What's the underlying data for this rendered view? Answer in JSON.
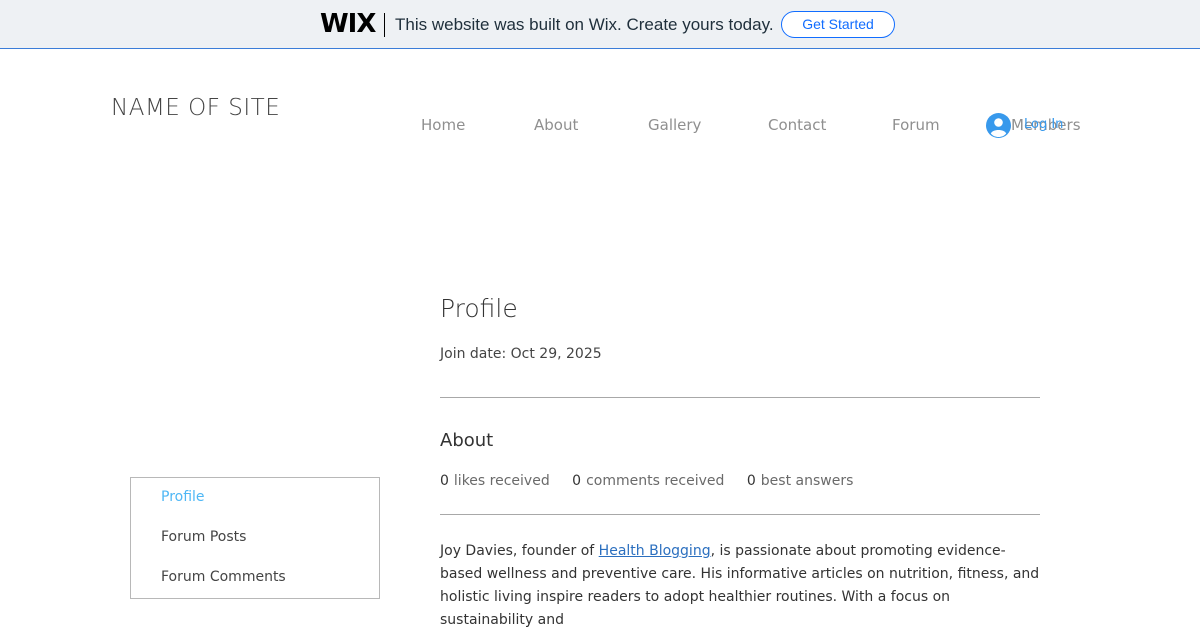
{
  "wix_banner": {
    "logo": "WIX",
    "message": "This website was built on Wix. Create yours today.",
    "cta_label": "Get Started",
    "accent_color": "#116dff"
  },
  "header": {
    "site_name": "NAME OF SITE",
    "nav": [
      {
        "label": "Home"
      },
      {
        "label": "About"
      },
      {
        "label": "Gallery"
      },
      {
        "label": "Contact"
      },
      {
        "label": "Forum"
      },
      {
        "label": "Members"
      }
    ],
    "login": {
      "label": "Log In",
      "icon": "user-avatar-icon"
    }
  },
  "side_menu": {
    "items": [
      {
        "label": "Profile",
        "active": true
      },
      {
        "label": "Forum Posts",
        "active": false
      },
      {
        "label": "Forum Comments",
        "active": false
      }
    ],
    "active_color": "#4eb7f5"
  },
  "profile": {
    "title": "Profile",
    "join_date": "Join date: Oct 29, 2025",
    "about_heading": "About",
    "stats": [
      {
        "value": "0",
        "label": "likes received"
      },
      {
        "value": "0",
        "label": "comments received"
      },
      {
        "value": "0",
        "label": "best answers"
      }
    ],
    "bio": {
      "before_link": "Joy Davies, founder of ",
      "link_text": "Health Blogging",
      "after_link": ", is passionate about promoting evidence-based wellness and preventive care. His informative articles on nutrition, fitness, and holistic living inspire readers to adopt healthier routines. With a focus on sustainability and"
    }
  }
}
